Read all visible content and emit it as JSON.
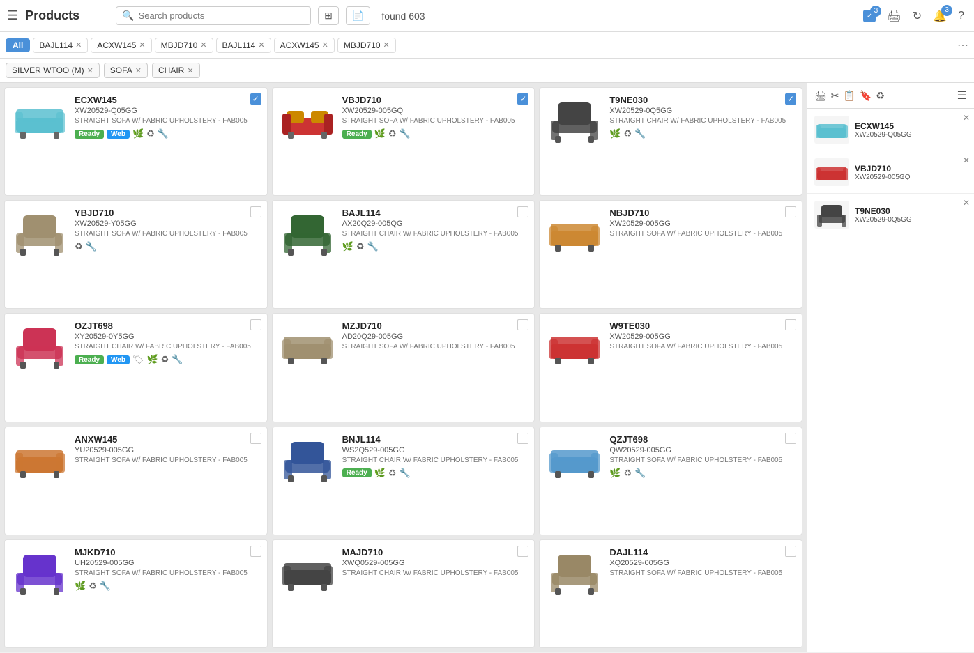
{
  "topbar": {
    "menu_label": "≡",
    "title": "Products",
    "search_placeholder": "Search products",
    "filter_icon": "⊞",
    "upload_icon": "📄",
    "found_count": "found 603",
    "actions": {
      "checkbox_count": "3",
      "print_icon": "🖨",
      "refresh_icon": "↻",
      "bell_count": "3",
      "help_icon": "?"
    }
  },
  "tabs": [
    {
      "label": "All",
      "active": true
    },
    {
      "label": "BAJL114",
      "closeable": true
    },
    {
      "label": "ACXW145",
      "closeable": true
    },
    {
      "label": "MBJD710",
      "closeable": true
    },
    {
      "label": "BAJL114",
      "closeable": true
    },
    {
      "label": "ACXW145",
      "closeable": true
    },
    {
      "label": "MBJD710",
      "closeable": true
    }
  ],
  "filters": [
    {
      "label": "SILVER WTOO (M)"
    },
    {
      "label": "SOFA"
    },
    {
      "label": "CHAIR"
    }
  ],
  "products": [
    {
      "name": "ECXW145",
      "sku": "XW20529-Q05GG",
      "desc": "STRAIGHT SOFA W/ FABRIC UPHOLSTERY - FAB005",
      "badges": [
        "Ready",
        "Web"
      ],
      "icons": [
        "eco",
        "recycle",
        "tools"
      ],
      "checked": true,
      "color": "#5bc0d0",
      "type": "sofa"
    },
    {
      "name": "VBJD710",
      "sku": "XW20529-005GQ",
      "desc": "STRAIGHT SOFA W/ FABRIC UPHOLSTERY - FAB005",
      "badges": [
        "Ready"
      ],
      "icons": [
        "eco",
        "recycle",
        "tools"
      ],
      "checked": true,
      "color": "#cc3333",
      "type": "sofa-yellow"
    },
    {
      "name": "T9NE030",
      "sku": "XW20529-0Q5GG",
      "desc": "STRAIGHT CHAIR W/ FABRIC UPHOLSTERY - FAB005",
      "badges": [],
      "icons": [
        "eco",
        "recycle",
        "tools"
      ],
      "checked": true,
      "color": "#444444",
      "type": "chair-dark"
    },
    {
      "name": "YBJD710",
      "sku": "XW20529-Y05GG",
      "desc": "STRAIGHT SOFA W/ FABRIC UPHOLSTERY - FAB005",
      "badges": [],
      "icons": [
        "recycle",
        "tools"
      ],
      "checked": false,
      "color": "#a09070",
      "type": "chair-beige"
    },
    {
      "name": "BAJL114",
      "sku": "AX20Q29-005QG",
      "desc": "STRAIGHT CHAIR W/ FABRIC UPHOLSTERY - FAB005",
      "badges": [],
      "icons": [
        "eco",
        "recycle",
        "tools"
      ],
      "checked": false,
      "color": "#336633",
      "type": "chair-green"
    },
    {
      "name": "NBJD710",
      "sku": "XW20529-005GG",
      "desc": "STRAIGHT SOFA W/ FABRIC UPHOLSTERY - FAB005",
      "badges": [],
      "icons": [],
      "checked": false,
      "color": "#cc8833",
      "type": "sofa-orange"
    },
    {
      "name": "OZJT698",
      "sku": "XY20529-0Y5GG",
      "desc": "STRAIGHT CHAIR W/ FABRIC UPHOLSTERY - FAB005",
      "badges": [
        "Ready",
        "Web"
      ],
      "icons": [
        "tag",
        "eco",
        "recycle",
        "tools"
      ],
      "checked": false,
      "color": "#cc3355",
      "type": "chair-red"
    },
    {
      "name": "MZJD710",
      "sku": "AD20Q29-005GG",
      "desc": "STRAIGHT SOFA W/ FABRIC UPHOLSTERY - FAB005",
      "badges": [],
      "icons": [],
      "checked": false,
      "color": "#a09070",
      "type": "sofa-beige"
    },
    {
      "name": "W9TE030",
      "sku": "XW20529-005GG",
      "desc": "STRAIGHT SOFA W/ FABRIC UPHOLSTERY - FAB005",
      "badges": [],
      "icons": [],
      "checked": false,
      "color": "#cc3333",
      "type": "sofa-red"
    },
    {
      "name": "ANXW145",
      "sku": "YU20529-005GG",
      "desc": "STRAIGHT SOFA W/ FABRIC UPHOLSTERY - FAB005",
      "badges": [],
      "icons": [],
      "checked": false,
      "color": "#cc7733",
      "type": "sofa-brown"
    },
    {
      "name": "BNJL114",
      "sku": "WS2Q529-005GG",
      "desc": "STRAIGHT CHAIR W/ FABRIC UPHOLSTERY - FAB005",
      "badges": [
        "Ready"
      ],
      "icons": [
        "eco",
        "recycle",
        "tools"
      ],
      "checked": false,
      "color": "#335599",
      "type": "chair-blue"
    },
    {
      "name": "QZJT698",
      "sku": "QW20529-005GG",
      "desc": "STRAIGHT SOFA W/ FABRIC UPHOLSTERY - FAB005",
      "badges": [],
      "icons": [
        "eco",
        "recycle",
        "tools"
      ],
      "checked": false,
      "color": "#5599cc",
      "type": "sofa-lightblue"
    },
    {
      "name": "MJKD710",
      "sku": "UH20529-005GG",
      "desc": "STRAIGHT SOFA W/ FABRIC UPHOLSTERY - FAB005",
      "badges": [],
      "icons": [
        "eco",
        "recycle",
        "tools"
      ],
      "checked": false,
      "color": "#6633cc",
      "type": "chair-purple"
    },
    {
      "name": "MAJD710",
      "sku": "XWQ0529-005GG",
      "desc": "STRAIGHT CHAIR W/ FABRIC UPHOLSTERY - FAB005",
      "badges": [],
      "icons": [],
      "checked": false,
      "color": "#444444",
      "type": "sofa-dark"
    },
    {
      "name": "DAJL114",
      "sku": "XQ20529-005GG",
      "desc": "STRAIGHT SOFA W/ FABRIC UPHOLSTERY - FAB005",
      "badges": [],
      "icons": [],
      "checked": false,
      "color": "#998866",
      "type": "chair-tan"
    }
  ],
  "right_panel": {
    "items": [
      {
        "name": "ECXW145",
        "sku": "XW20529-Q05GG",
        "color": "#5bc0d0",
        "type": "sofa"
      },
      {
        "name": "VBJD710",
        "sku": "XW20529-005GQ",
        "color": "#cc3333",
        "type": "sofa-yellow"
      },
      {
        "name": "T9NE030",
        "sku": "XW20529-0Q5GG",
        "color": "#444444",
        "type": "chair-dark"
      }
    ]
  }
}
